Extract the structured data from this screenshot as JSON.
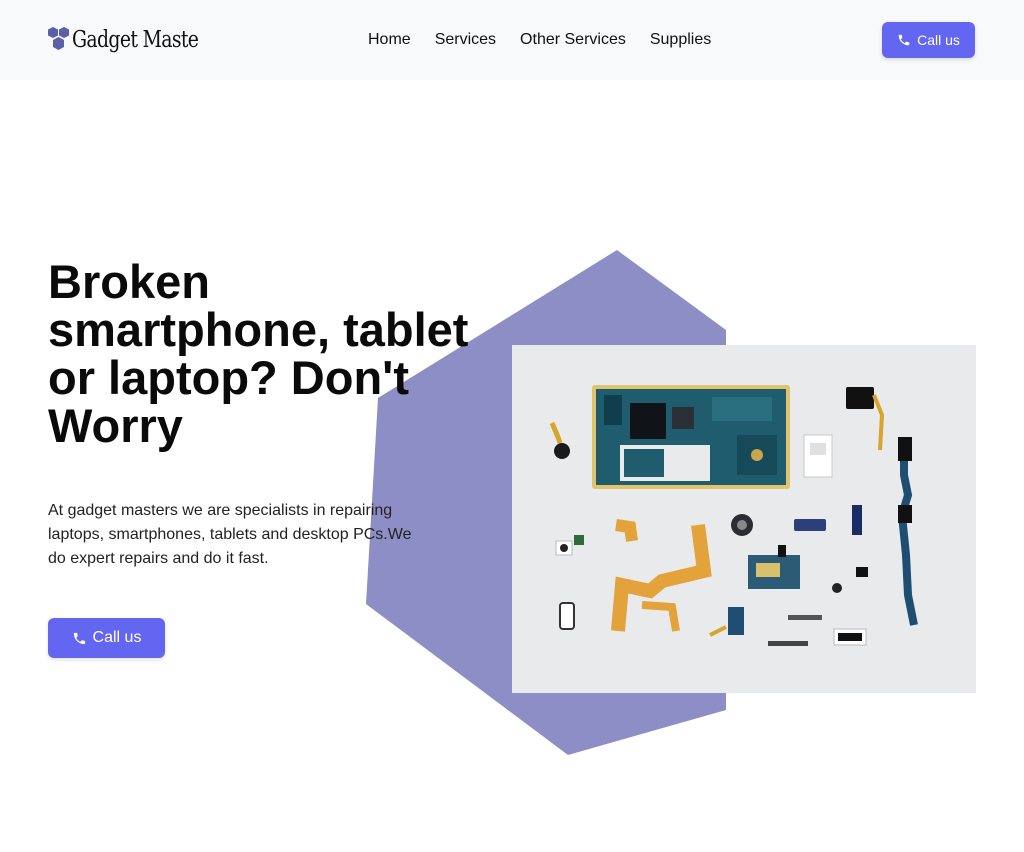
{
  "brand": {
    "name": "Gadget Masters",
    "logo_icon": "hexagon-cluster-logo",
    "logo_color": "#5b5fa6"
  },
  "nav": {
    "items": [
      {
        "label": "Home"
      },
      {
        "label": "Services"
      },
      {
        "label": "Other Services"
      },
      {
        "label": "Supplies"
      }
    ]
  },
  "header": {
    "cta_label": "Call us",
    "cta_icon": "phone-icon"
  },
  "hero": {
    "headline": "Broken smartphone, tablet or laptop? Don't Worry",
    "lead": "At gadget masters we are specialists in repairing laptops, smartphones, tablets and desktop PCs.We do expert repairs and do it fast.",
    "cta_label": "Call us",
    "cta_icon": "phone-icon",
    "image_subject": "disassembled smartphone components on grey background",
    "hexagon_color": "#8e8ec6"
  },
  "colors": {
    "accent": "#6366f1",
    "header_bg": "#f8f9fb"
  }
}
